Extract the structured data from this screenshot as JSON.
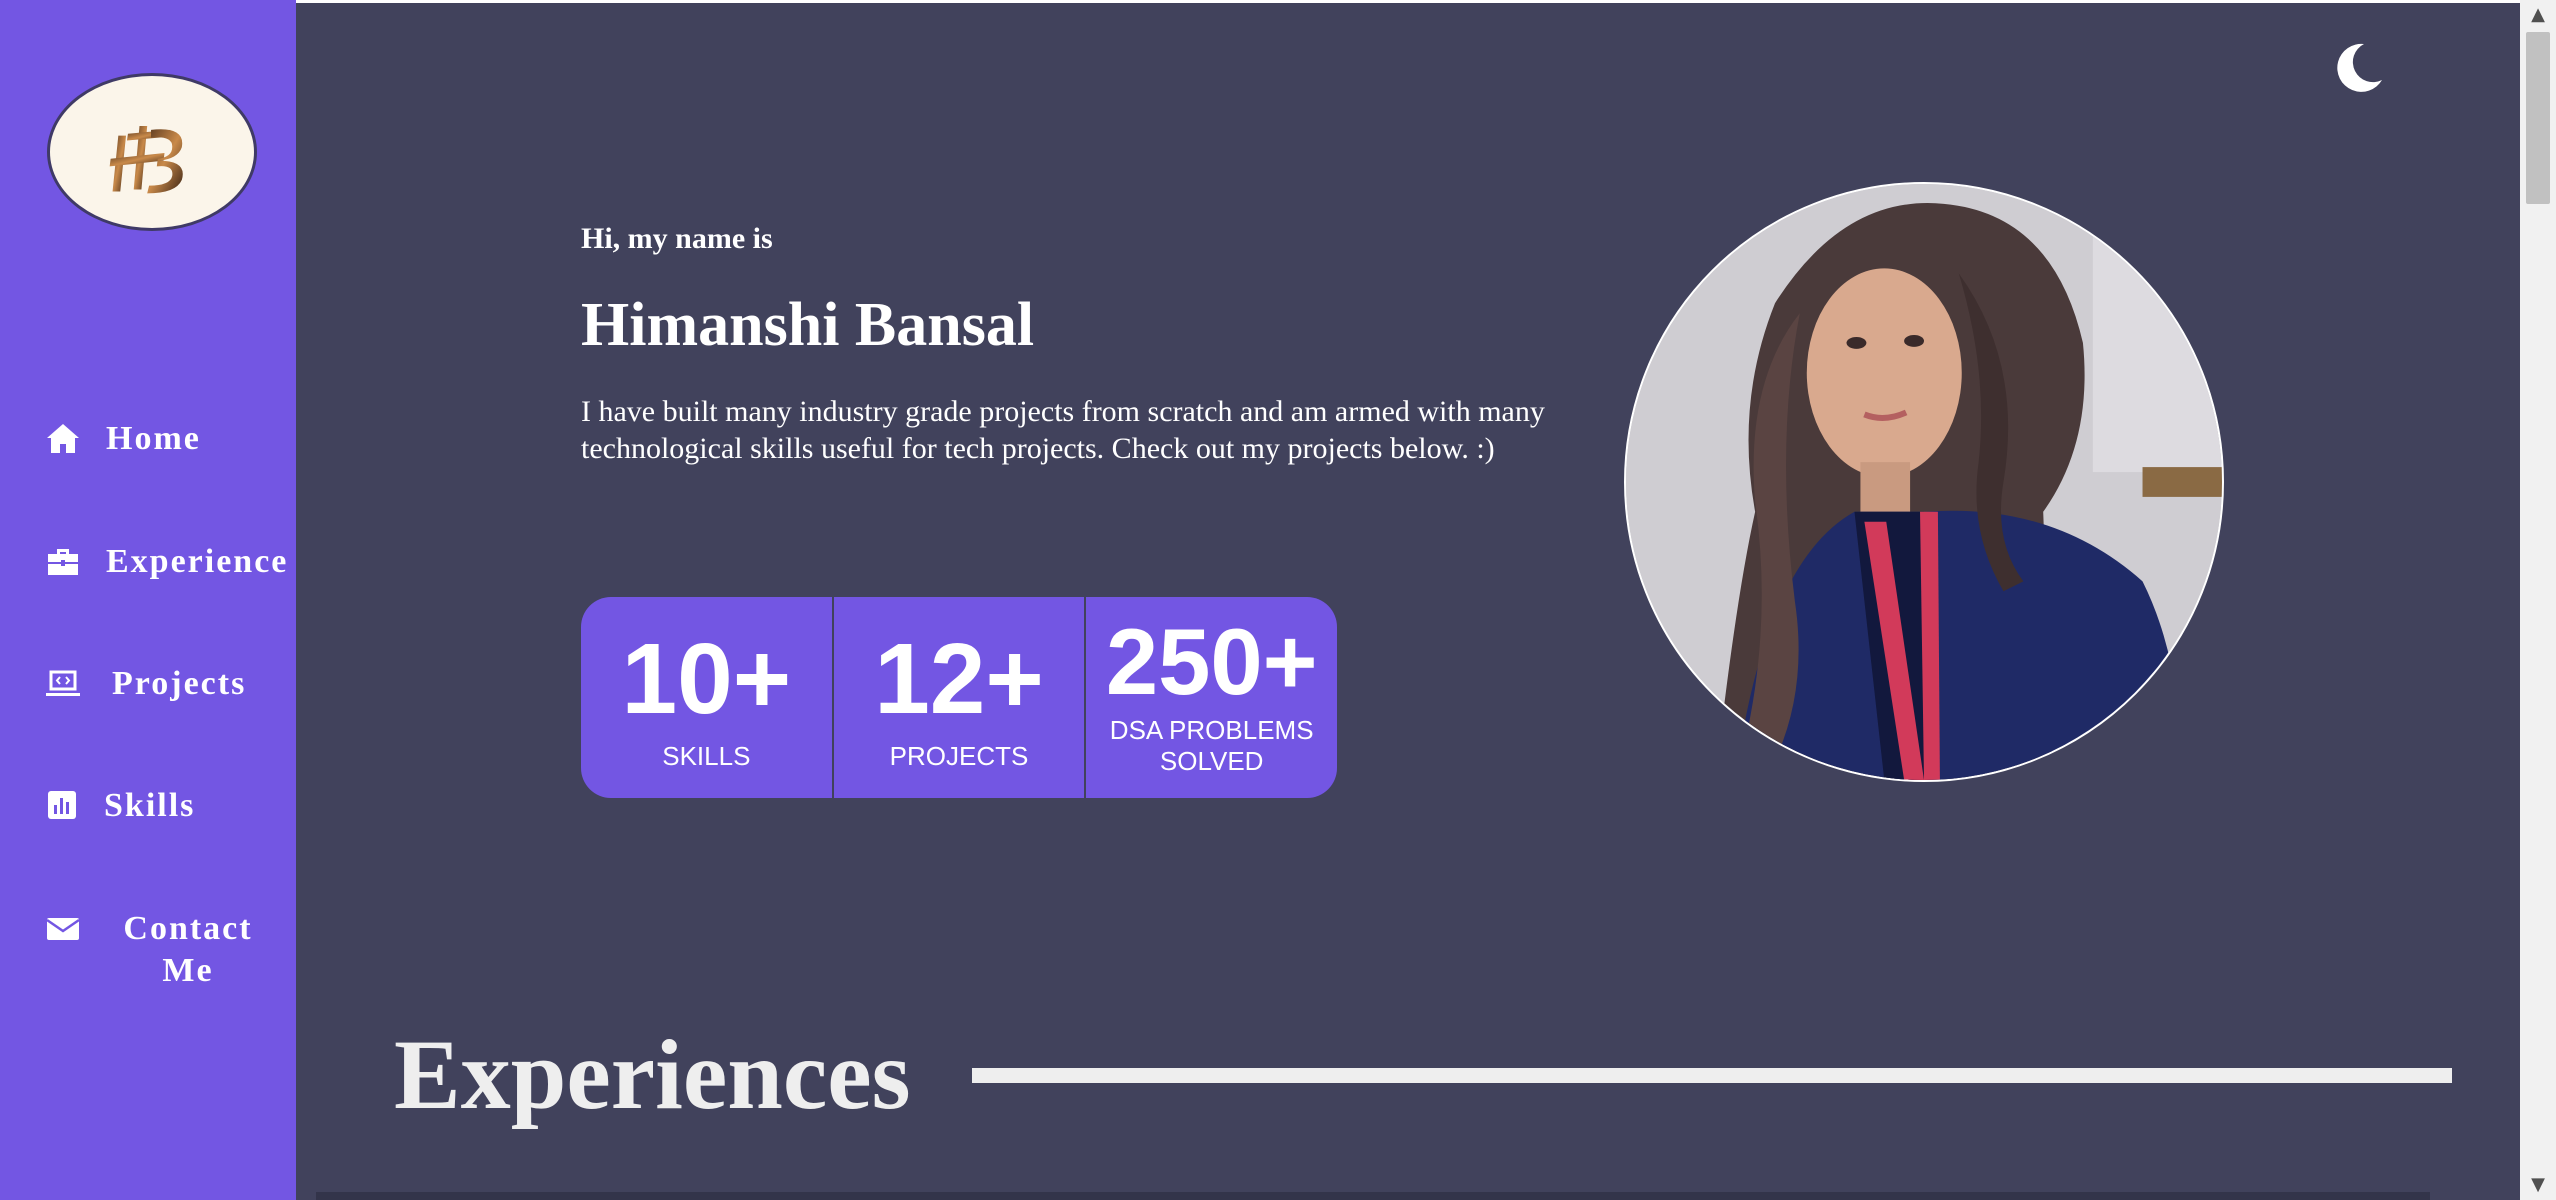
{
  "sidebar": {
    "logo_text": "HB",
    "items": [
      {
        "label": "Home",
        "icon": "home-icon"
      },
      {
        "label": "Experience",
        "icon": "briefcase-icon"
      },
      {
        "label": "Projects",
        "icon": "laptop-code-icon"
      },
      {
        "label": "Skills",
        "icon": "chart-bar-icon"
      },
      {
        "label": "Contact Me",
        "icon": "envelope-icon"
      }
    ]
  },
  "header": {
    "theme_toggle_icon": "moon-icon"
  },
  "hero": {
    "greeting": "Hi, my name is",
    "name": "Himanshi Bansal",
    "bio": "I have built many industry grade projects from scratch and am armed with many technological skills useful for tech projects. Check out my projects below. :)",
    "stats": [
      {
        "value": "10+",
        "label": "SKILLS"
      },
      {
        "value": "12+",
        "label": "PROJECTS"
      },
      {
        "value": "250+",
        "label": "DSA PROBLEMS SOLVED"
      }
    ],
    "photo_icon": "profile-photo"
  },
  "sections": {
    "experiences_title": "Experiences"
  },
  "colors": {
    "accent": "#7356e3",
    "background": "#41425c",
    "text": "#ffffff"
  }
}
